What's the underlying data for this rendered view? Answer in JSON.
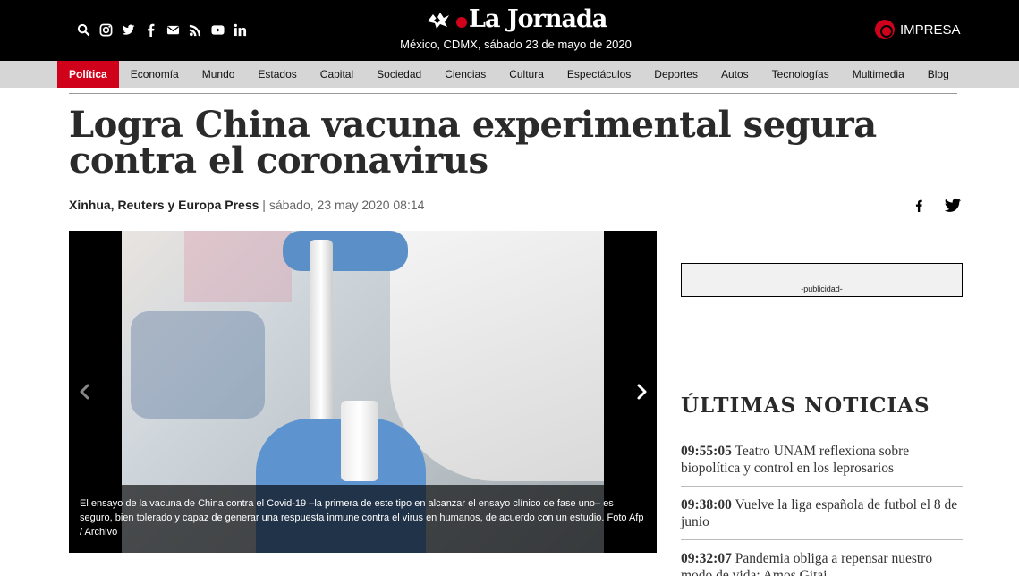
{
  "header": {
    "social_icons": [
      "search-icon",
      "instagram-icon",
      "twitter-icon",
      "facebook-icon",
      "email-icon",
      "rss-icon",
      "youtube-icon",
      "linkedin-icon"
    ],
    "logo_text": "La Jornada",
    "date_line": "México, CDMX, sábado 23 de mayo de 2020",
    "impresa_label": "IMPRESA"
  },
  "nav": {
    "items": [
      {
        "label": "Política",
        "active": true
      },
      {
        "label": "Economía"
      },
      {
        "label": "Mundo"
      },
      {
        "label": "Estados"
      },
      {
        "label": "Capital"
      },
      {
        "label": "Sociedad"
      },
      {
        "label": "Ciencias"
      },
      {
        "label": "Cultura"
      },
      {
        "label": "Espectáculos"
      },
      {
        "label": "Deportes"
      },
      {
        "label": "Autos"
      },
      {
        "label": "Tecnologías"
      },
      {
        "label": "Multimedia"
      },
      {
        "label": "Blog"
      }
    ]
  },
  "article": {
    "headline": "Logra China vacuna experimental segura contra el coronavirus",
    "author": "Xinhua, Reuters y Europa Press",
    "separator": "|",
    "datetime": "sábado, 23 may 2020 08:14",
    "share_icons": [
      "facebook-icon",
      "twitter-icon"
    ],
    "caption": "El ensayo de la vacuna de China contra el Covid-19 –la primera de este tipo en alcanzar el ensayo clínico de fase uno– es seguro, bien tolerado y capaz de generar una respuesta inmune contra el virus en humanos, de acuerdo con un estudio. Foto Afp / Archivo"
  },
  "sidebar": {
    "ad_label": "-publicidad-",
    "latest_title": "ÚLTIMAS NOTICIAS",
    "news": [
      {
        "time": "09:55:05",
        "text": "Teatro UNAM reflexiona sobre biopolítica y control en los leprosarios"
      },
      {
        "time": "09:38:00",
        "text": "Vuelve la liga española de futbol el 8 de junio"
      },
      {
        "time": "09:32:07",
        "text": "Pandemia obliga a repensar nuestro modo de vida: Amos Gitai"
      }
    ]
  },
  "colors": {
    "brand_red": "#d0021b",
    "header_bg": "#000000",
    "nav_bg": "#d6d6d6"
  }
}
